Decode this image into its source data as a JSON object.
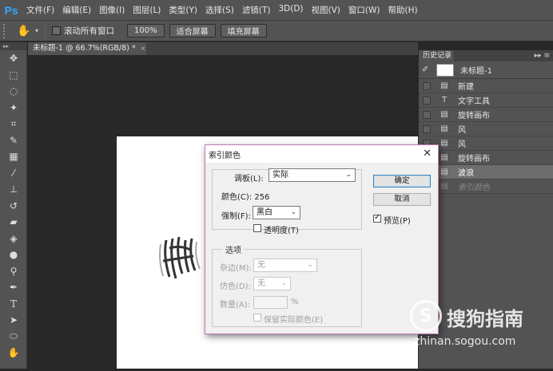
{
  "app": {
    "logo": "Ps"
  },
  "menu": [
    "文件(F)",
    "编辑(E)",
    "图像(I)",
    "图层(L)",
    "类型(Y)",
    "选择(S)",
    "滤镜(T)",
    "3D(D)",
    "视图(V)",
    "窗口(W)",
    "帮助(H)"
  ],
  "options": {
    "scroll_all_label": "滚动所有窗口",
    "zoom_100": "100%",
    "fit_screen": "适合屏幕",
    "fill_screen": "填充屏幕"
  },
  "document": {
    "tab_title": "未标题-1 @ 66.7%(RGB/8) *",
    "close": "×"
  },
  "history": {
    "tab": "历史记录",
    "menu": "▸▸ ≡",
    "snapshot": "未标题-1",
    "items": [
      {
        "label": "新建",
        "icon": "doc-icon"
      },
      {
        "label": "文字工具",
        "icon": "type-icon"
      },
      {
        "label": "旋转画布",
        "icon": "doc-icon"
      },
      {
        "label": "风",
        "icon": "doc-icon"
      },
      {
        "label": "风",
        "icon": "doc-icon"
      },
      {
        "label": "旋转画布",
        "icon": "doc-icon"
      },
      {
        "label": "波浪",
        "icon": "doc-icon",
        "selected": true
      },
      {
        "label": "索引颜色",
        "icon": "doc-icon",
        "dim": true
      }
    ]
  },
  "dialog": {
    "title": "索引颜色",
    "close": "✕",
    "palette_label": "调板(L):",
    "palette_value": "实际",
    "colors_label": "颜色(C): 256",
    "forced_label": "强制(F):",
    "forced_value": "黑白",
    "transparency_label": "透明度(T)",
    "options_legend": "选项",
    "matte_label": "杂边(M):",
    "matte_value": "无",
    "dither_label": "仿色(D):",
    "dither_value": "无",
    "amount_label": "数量(A):",
    "amount_unit": "%",
    "preserve_label": "保留实际颜色(E)",
    "ok": "确定",
    "cancel": "取消",
    "preview_label": "预览(P)"
  },
  "watermark": {
    "name": "搜狗指南",
    "url": "zhinan.sogou.com",
    "logo": "S"
  },
  "colors": {
    "accent_ps": "#31a8ff",
    "dialog_border": "#c17bb1",
    "selected_row": "#6d6d6d"
  }
}
